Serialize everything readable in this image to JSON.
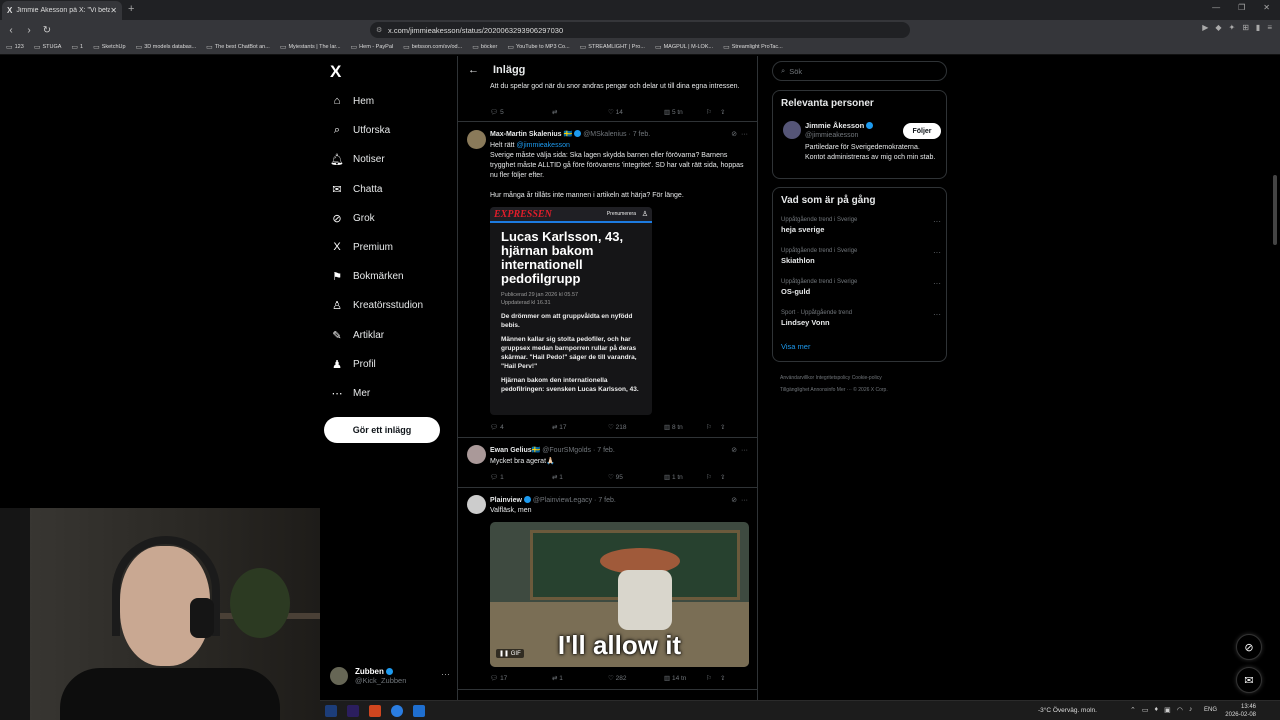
{
  "browser": {
    "tab_title": "Jimmie Åkesson på X: \"Vi betala...",
    "url": "x.com/jimmieakesson/status/2020063293906297030",
    "bookmarks": [
      "123",
      "STUGA",
      "1",
      "SketchUp",
      "3D models databas...",
      "The best ChatBot an...",
      "Myiestants | The lar...",
      "Hem - PayPal",
      "betsson.com/sv/od...",
      "böcker",
      "YouTube to MP3 Co...",
      "STREAMLIGHT | Pro...",
      "MAGPUL | M-LOK...",
      "Streamlight ProTac..."
    ]
  },
  "nav": {
    "logo": "X",
    "items": [
      {
        "label": "Hem",
        "icon": "home-icon",
        "glyph": "⌂"
      },
      {
        "label": "Utforska",
        "icon": "search-icon",
        "glyph": "⌕"
      },
      {
        "label": "Notiser",
        "icon": "bell-icon",
        "glyph": "🔔︎"
      },
      {
        "label": "Chatta",
        "icon": "mail-icon",
        "glyph": "✉"
      },
      {
        "label": "Grok",
        "icon": "grok-icon",
        "glyph": "⊘"
      },
      {
        "label": "Premium",
        "icon": "x-icon",
        "glyph": "X"
      },
      {
        "label": "Bokmärken",
        "icon": "bookmark-icon",
        "glyph": "⚑"
      },
      {
        "label": "Kreatörsstudion",
        "icon": "studio-icon",
        "glyph": "♙"
      },
      {
        "label": "Artiklar",
        "icon": "article-icon",
        "glyph": "✎"
      },
      {
        "label": "Profil",
        "icon": "person-icon",
        "glyph": "♟"
      },
      {
        "label": "Mer",
        "icon": "more-icon",
        "glyph": "⋯"
      }
    ],
    "post_button": "Gör ett inlägg",
    "account": {
      "name": "Zubben",
      "handle": "@Kick_Zubben"
    }
  },
  "post": {
    "header_title": "Inlägg",
    "top_text": "Att du spelar god när du snor andras pengar och delar ut till dina egna intressen.",
    "top_actions": {
      "replies": "5",
      "reposts": "",
      "likes": "14",
      "views": "5 tn"
    },
    "replies": [
      {
        "name": "Max-Martin Skalenius 🇸🇪",
        "handle": "@MSkalenius · 7 feb.",
        "text1": "Helt rätt ",
        "mention": "@jimmieakesson",
        "text2": "Sverige måste välja sida: Ska lagen skydda barnen eller förövarna? Barnens trygghet måste ALLTID gå före förövarens 'integritet'. SD har valt rätt sida, hoppas nu fler följer efter.",
        "text3": "Hur många år tillåts inte mannen i artikeln att härja? För länge.",
        "actions": {
          "replies": "4",
          "reposts": "17",
          "likes": "218",
          "views": "8 tn"
        }
      },
      {
        "name": "Ewan Gelius🇸🇪",
        "handle": "@FourSMgolds · 7 feb.",
        "text": "Mycket bra agerat🙏🏻",
        "actions": {
          "replies": "1",
          "reposts": "1",
          "likes": "95",
          "views": "1 tn"
        }
      },
      {
        "name": "Plainview",
        "handle": "@PlainviewLegacy · 7 feb.",
        "text": "Valfläsk, men",
        "actions": {
          "replies": "17",
          "reposts": "1",
          "likes": "282",
          "views": "14 tn"
        }
      }
    ],
    "article": {
      "logo": "EXPRESSEN",
      "subscribe": "Prenumerera",
      "headline": "Lucas Karlsson, 43, hjärnan bakom internationell pedofilgrupp",
      "meta1": "Publicerad 29 jan 2026 kl 05.57",
      "meta2": "Uppdaterad kl 16.31",
      "p1": "De drömmer om att gruppvåldta en nyfödd bebis.",
      "p2": "Männen kallar sig stolta pedofiler, och har gruppsex medan barnporren rullar på deras skärmar. \"Hail Pedo!\" säger de till varandra, \"Hail Perv!\"",
      "p3": "Hjärnan bakom den internationella pedofilringen: svensken Lucas Karlsson, 43."
    },
    "gif": {
      "caption": "I'll allow it",
      "badge": "GIF"
    }
  },
  "right": {
    "search_placeholder": "Sök",
    "people_title": "Relevanta personer",
    "person": {
      "name": "Jimmie Åkesson",
      "handle": "@jimmieakesson",
      "follow": "Följer",
      "bio": "Partiledare för Sverigedemokraterna. Kontot administreras av mig och min stab."
    },
    "trends_title": "Vad som är på gång",
    "trends": [
      {
        "ctx": "Uppåtgående trend i Sverige",
        "name": "heja sverige"
      },
      {
        "ctx": "Uppåtgående trend i Sverige",
        "name": "Skiathlon"
      },
      {
        "ctx": "Uppåtgående trend i Sverige",
        "name": "OS-guld"
      },
      {
        "ctx": "Sport · Uppåtgående trend",
        "name": "Lindsey Vonn"
      }
    ],
    "show_more": "Visa mer",
    "footer1": "Användarvillkor   Integritetspolicy   Cookie-policy",
    "footer2": "Tillgänglighet   Annonsinfo   Mer ···   © 2026 X Corp."
  },
  "taskbar": {
    "weather": "-3°C  Överväg. moln.",
    "lang": "ENG",
    "time": "13:46",
    "date": "2026-02-08"
  },
  "colors": {
    "accent": "#1d9bf0",
    "bg": "#000000",
    "border": "#2f3336",
    "muted": "#71767b"
  }
}
